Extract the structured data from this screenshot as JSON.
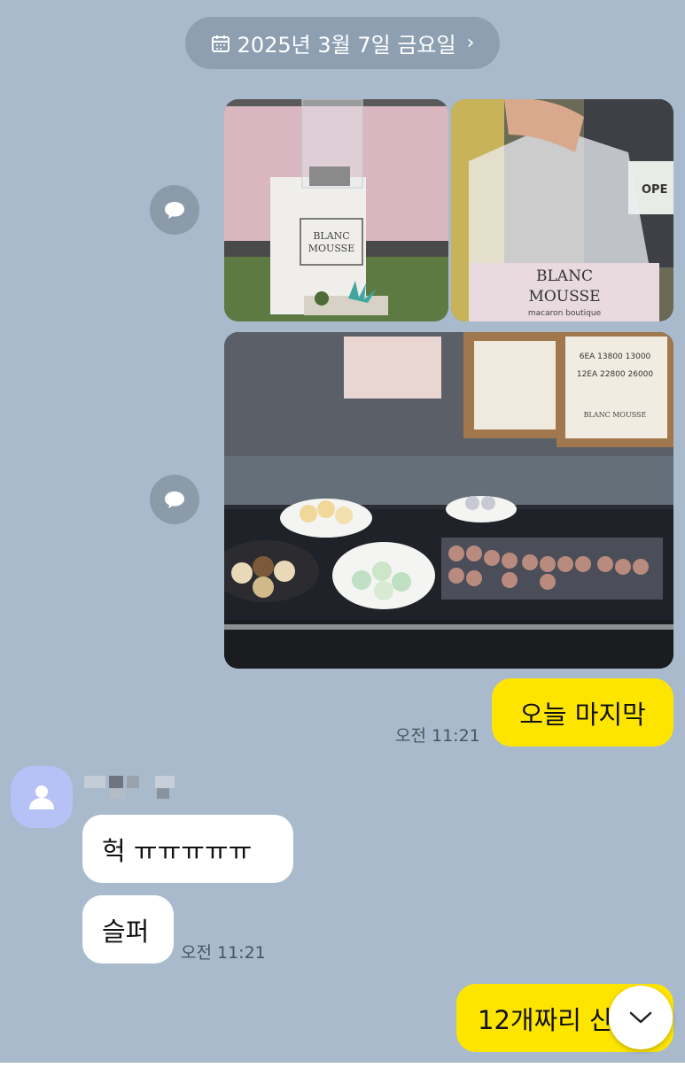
{
  "date_divider": {
    "label": "2025년 3월 7일 금요일",
    "chevron": "›"
  },
  "photos": [
    {
      "shop_sign_line1": "BLANC",
      "shop_sign_line2": "MOUSSE"
    },
    {
      "bag_line1": "BLANC",
      "bag_line2": "MOUSSE",
      "bag_line3": "macaron boutique",
      "door_sign": "OPE"
    },
    {
      "price_row1": "6EA  13800  13000",
      "price_row2": "12EA  22800  26000",
      "board_brand": "BLANC MOUSSE"
    }
  ],
  "messages": {
    "me_1": {
      "text": "오늘 마지막",
      "time": "오전 11:21"
    },
    "them_1": {
      "text": "헉 ㅠㅠㅠㅠㅠ"
    },
    "them_2": {
      "text": "슬퍼",
      "time": "오전 11:21"
    },
    "me_2": {
      "text": "12개짜리 산다"
    }
  },
  "icons": {
    "calendar": "calendar-icon",
    "share": "share-icon",
    "avatar": "default-profile-icon",
    "scroll_down": "chevron-down-icon"
  },
  "colors": {
    "chat_background": "#a9bacc",
    "my_bubble": "#fee500",
    "their_bubble": "#ffffff",
    "date_pill": "#8e9fb1"
  }
}
